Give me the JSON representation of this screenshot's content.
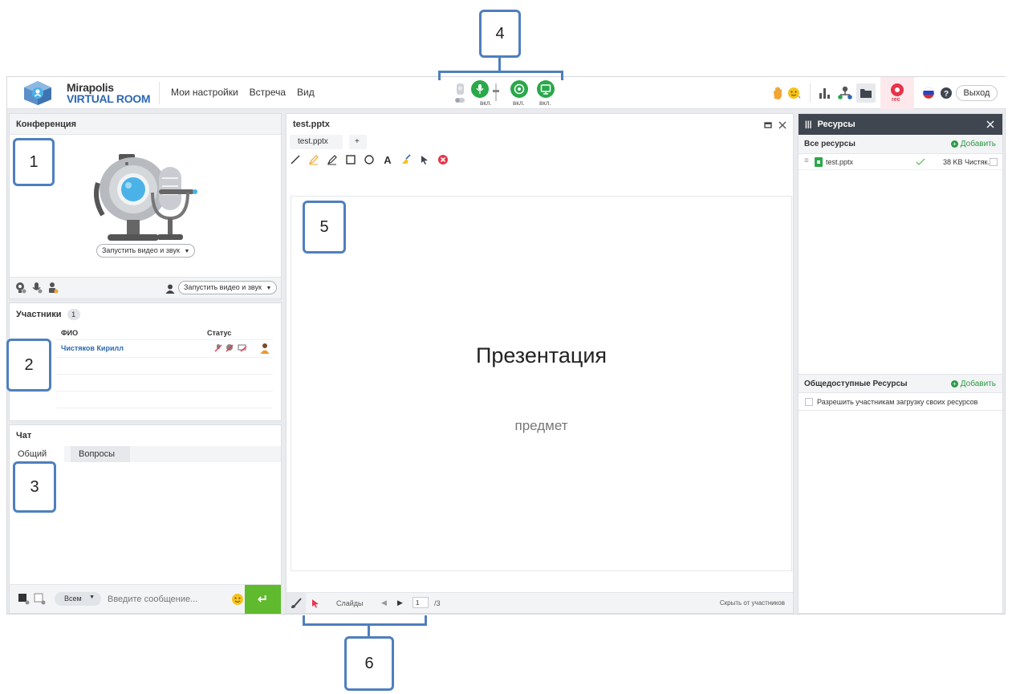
{
  "topbar": {
    "logo_line1": "Mirapolis",
    "logo_line2": "VIRTUAL ROOM",
    "menu": [
      "Мои настройки",
      "Встреча",
      "Вид"
    ],
    "mic_label": "вкл.",
    "camera_label": "вкл.",
    "screen_label": "вкл.",
    "rec_label": "rec",
    "exit_label": "Выход"
  },
  "conference": {
    "title": "Конференция",
    "start_button": "Запустить видео и звук",
    "bottom_start_button": "Запустить видео и звук"
  },
  "participants": {
    "title": "Участники",
    "count": "1",
    "col_name": "ФИО",
    "col_status": "Статус",
    "rows": [
      {
        "name": "Чистяков Кирилл"
      }
    ]
  },
  "chat": {
    "title": "Чат",
    "tabs": [
      "Общий",
      "Вопросы"
    ],
    "recipient": "Всем",
    "input_placeholder": "Введите сообщение...",
    "send_symbol": "↵"
  },
  "presentation": {
    "title": "test.pptx",
    "tab_label": "test.pptx",
    "add_tab": "+",
    "slide_title": "Презентация",
    "slide_subtitle": "предмет",
    "slides_label": "Слайды",
    "current_page": "1",
    "total_pages": "/3",
    "hide_label": "Скрыть от участников"
  },
  "resources": {
    "title": "Ресурсы",
    "all_title": "Все ресурсы",
    "add_label": "Добавить",
    "file_name": "test.pptx",
    "file_info": "38 KB Чистяк...",
    "public_title": "Общедоступные Ресурсы",
    "public_add_label": "Добавить",
    "allow_upload": "Разрешить участникам загрузку своих ресурсов"
  },
  "callouts": [
    "1",
    "2",
    "3",
    "4",
    "5",
    "6"
  ],
  "colors": {
    "green": "#2aa84a",
    "chat_send": "#5fba2d",
    "callout_border": "#4e7fbe",
    "resources_header": "#3f4650",
    "rec_red": "#e8334a",
    "link_blue": "#2d67b5"
  }
}
